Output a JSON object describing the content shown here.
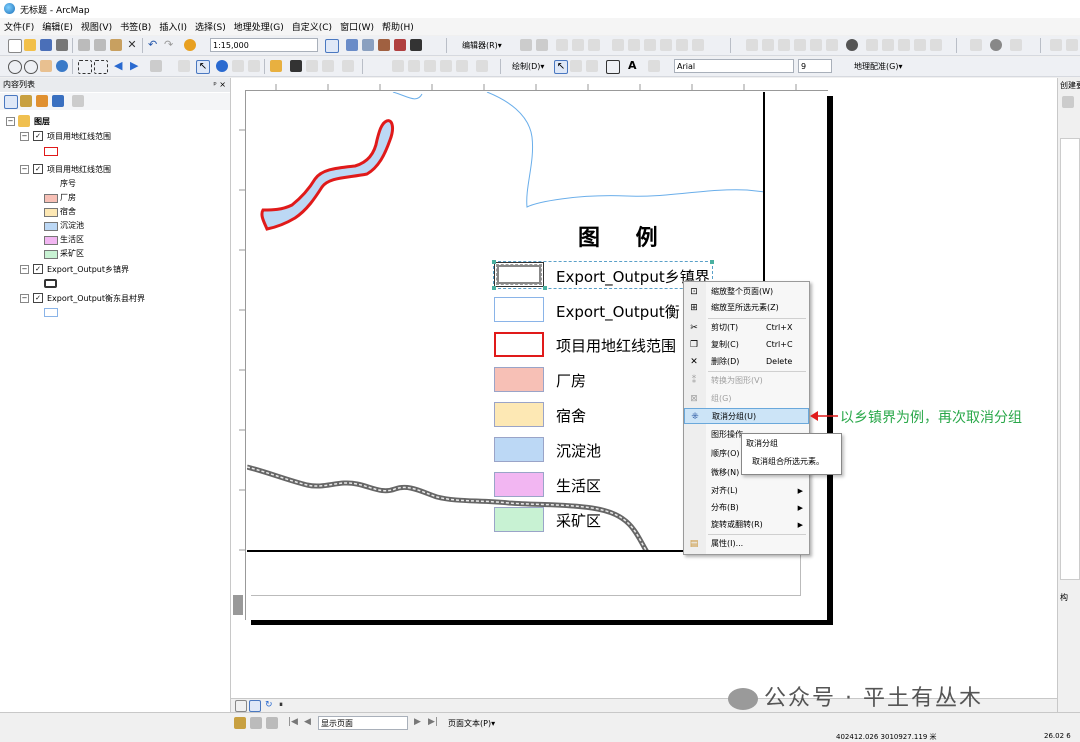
{
  "window": {
    "title": "无标题 - ArcMap"
  },
  "menubar": [
    "文件(F)",
    "编辑(E)",
    "视图(V)",
    "书签(B)",
    "插入(I)",
    "选择(S)",
    "地理处理(G)",
    "自定义(C)",
    "窗口(W)",
    "帮助(H)"
  ],
  "toolbar1": {
    "scale": "1:15,000",
    "editor_label": "编辑器(R)▾"
  },
  "toolbar2": {
    "draw_label": "绘制(D)▾",
    "font": "Arial",
    "font_size": "9",
    "georef_label": "地理配准(G)▾",
    "text_tool": "A"
  },
  "toc": {
    "title": "内容列表",
    "pin": "ᵖ ×",
    "root": "图层",
    "items": [
      {
        "label": "项目用地红线范围"
      },
      {
        "label": "项目用地红线范围",
        "field": "序号",
        "classes": [
          {
            "label": "厂房",
            "color": "#f7c0b6"
          },
          {
            "label": "宿舍",
            "color": "#fde8b4"
          },
          {
            "label": "沉淀池",
            "color": "#bcd8f5"
          },
          {
            "label": "生活区",
            "color": "#f2b6f2"
          },
          {
            "label": "采矿区",
            "color": "#c8f2d3"
          }
        ]
      },
      {
        "label": "Export_Output乡镇界"
      },
      {
        "label": "Export_Output衡东县村界"
      }
    ]
  },
  "legend": {
    "title": "图 例",
    "items": [
      {
        "label": "Export_Output乡镇界",
        "fill": "#ffffff",
        "border": "#555555",
        "kind": "town"
      },
      {
        "label": "Export_Output衡",
        "fill": "#ffffff",
        "border": "#8ab4e8",
        "kind": "village"
      },
      {
        "label": "项目用地红线范围",
        "fill": "#ffffff",
        "border": "#e01a1a",
        "kind": "redline"
      },
      {
        "label": "厂房",
        "fill": "#f7c0b6",
        "border": "#9aa4c8",
        "kind": "class"
      },
      {
        "label": "宿舍",
        "fill": "#fde8b4",
        "border": "#9aa4c8",
        "kind": "class"
      },
      {
        "label": "沉淀池",
        "fill": "#bcd8f5",
        "border": "#9aa4c8",
        "kind": "class"
      },
      {
        "label": "生活区",
        "fill": "#f2b6f2",
        "border": "#9aa4c8",
        "kind": "class"
      },
      {
        "label": "采矿区",
        "fill": "#c8f2d3",
        "border": "#9aa4c8",
        "kind": "class"
      }
    ]
  },
  "context_menu": {
    "items": [
      {
        "label": "缩放整个页面(W)",
        "icon": "zoom-page-icon",
        "glyph": "⊡",
        "enabled": true
      },
      {
        "label": "缩放至所选元素(Z)",
        "icon": "zoom-selected-icon",
        "glyph": "⊞",
        "enabled": true
      },
      {
        "label": "剪切(T)",
        "shortcut": "Ctrl+X",
        "icon": "scissors-icon",
        "glyph": "✂",
        "enabled": true
      },
      {
        "label": "复制(C)",
        "shortcut": "Ctrl+C",
        "icon": "copy-icon",
        "glyph": "❐",
        "enabled": true
      },
      {
        "label": "删除(D)",
        "shortcut": "Delete",
        "icon": "delete-icon",
        "glyph": "✕",
        "enabled": true
      },
      {
        "label": "转换为图形(V)",
        "icon": "convert-graphics-icon",
        "glyph": "⁑",
        "enabled": false
      },
      {
        "label": "组(G)",
        "icon": "group-icon",
        "glyph": "⊠",
        "enabled": false
      },
      {
        "label": "取消分组(U)",
        "icon": "ungroup-icon",
        "glyph": "⁜",
        "enabled": true,
        "highlight": true
      },
      {
        "label": "图形操作",
        "enabled": true
      },
      {
        "label": "顺序(O)",
        "enabled": true
      },
      {
        "label": "微移(N)",
        "enabled": true
      },
      {
        "label": "对齐(L)",
        "submenu": true,
        "enabled": true
      },
      {
        "label": "分布(B)",
        "submenu": true,
        "enabled": true
      },
      {
        "label": "旋转或翻转(R)",
        "submenu": true,
        "enabled": true
      },
      {
        "label": "属性(I)...",
        "icon": "properties-icon",
        "glyph": "▤",
        "enabled": true
      }
    ],
    "tooltip": {
      "title": "取消分组",
      "desc": "取消组合所选元素。"
    }
  },
  "annotation": "以乡镇界为例，再次取消分组",
  "annotation_color": "#2aa84a",
  "right_panel": {
    "title": "创建要",
    "section": "构"
  },
  "bottom": {
    "page_label": "显示页面",
    "page_text": "页面文本(P)▾"
  },
  "statusbar": {
    "coords": "402412.026  3010927.119 米",
    "extra": "26.02  6"
  },
  "watermark": "公众号 · 平土有丛木"
}
